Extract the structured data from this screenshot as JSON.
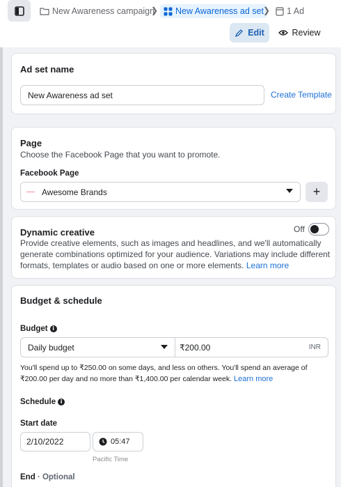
{
  "breadcrumbs": {
    "campaign": "New Awareness campaign",
    "adset": "New Awareness ad set",
    "ad": "1 Ad"
  },
  "toolbar": {
    "edit_label": "Edit",
    "review_label": "Review"
  },
  "adset_name": {
    "title": "Ad set name",
    "value": "New Awareness ad set",
    "create_template": "Create Template"
  },
  "page_section": {
    "title": "Page",
    "description": "Choose the Facebook Page that you want to promote.",
    "field_label": "Facebook Page",
    "selected_page": "Awesome Brands",
    "add_button": "+"
  },
  "dynamic_creative": {
    "title": "Dynamic creative",
    "toggle_label": "Off",
    "description": "Provide creative elements, such as images and headlines, and we'll automatically generate combinations optimized for your audience. Variations may include different formats, templates or audio based on one or more elements.",
    "learn_more": "Learn more"
  },
  "budget_schedule": {
    "title": "Budget & schedule",
    "budget_label": "Budget",
    "budget_type": "Daily budget",
    "budget_amount": "₹200.00",
    "currency": "INR",
    "budget_note": "You'll spend up to ₹250.00 on some days, and less on others. You'll spend an average of ₹200.00 per day and no more than ₹1,400.00 per calendar week.",
    "learn_more": "Learn more",
    "schedule_label": "Schedule",
    "start_date_label": "Start date",
    "start_date": "2/10/2022",
    "start_time": "05:47",
    "timezone": "Pacific Time",
    "end_label": "End",
    "end_optional": "· Optional"
  },
  "colors": {
    "accent": "#1b6fd6",
    "active_crumb_bg": "#e7f3ff",
    "page_swatch": "#f28b96"
  }
}
